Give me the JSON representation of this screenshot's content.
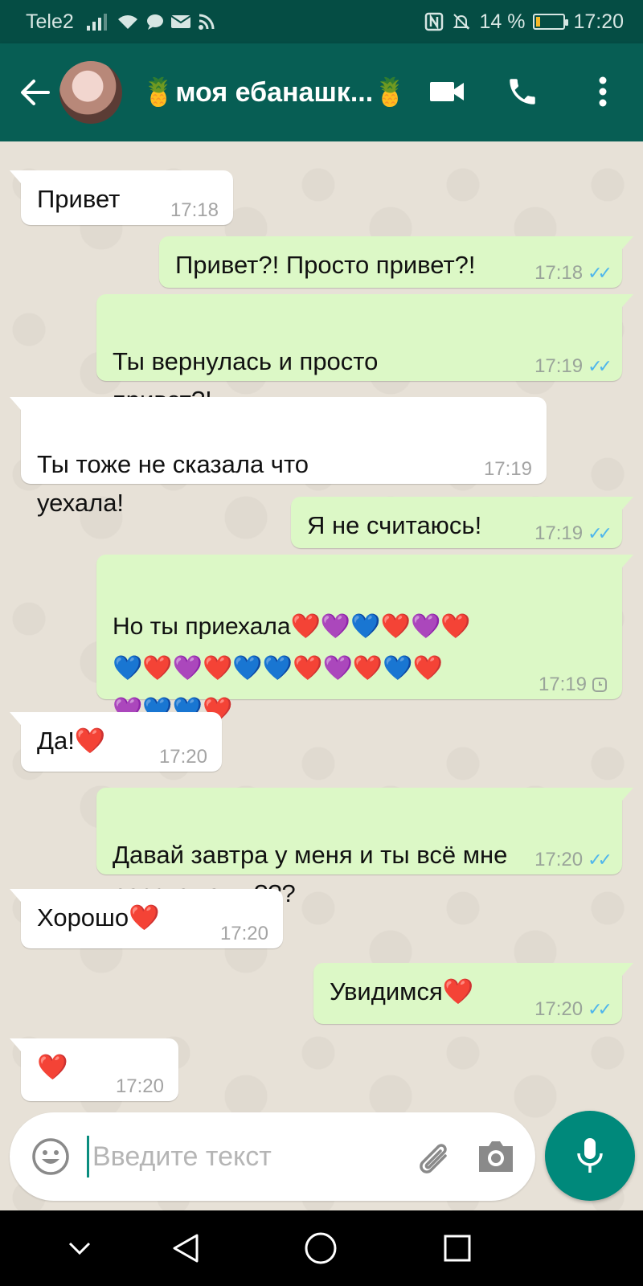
{
  "status_bar": {
    "carrier": "Tele2",
    "battery_percent": "14 %",
    "battery_level": 0.14,
    "time": "17:20"
  },
  "header": {
    "contact_name": "🍍моя ебанашк...🍍"
  },
  "messages": [
    {
      "dir": "in",
      "text": "Привет",
      "time": "17:18"
    },
    {
      "dir": "out",
      "text": "Привет?! Просто привет?!",
      "time": "17:18",
      "status": "read"
    },
    {
      "dir": "out",
      "text": "Ты вернулась и просто\nпривет?!",
      "time": "17:19",
      "status": "read"
    },
    {
      "dir": "in",
      "text": "Ты тоже не сказала что\nуехала!",
      "time": "17:19"
    },
    {
      "dir": "out",
      "text": "Я не считаюсь!",
      "time": "17:19",
      "status": "read"
    },
    {
      "dir": "out",
      "text": "Но ты приехала❤️💜💙❤️💜❤️\n💙❤️💜❤️💙💙❤️💜❤️💙❤️\n💜💙💙❤️",
      "time": "17:19",
      "status": "pending"
    },
    {
      "dir": "in",
      "text": "Да!❤️",
      "time": "17:20"
    },
    {
      "dir": "out",
      "text": "Давай завтра у меня и ты всё мне\nрасскажешь???",
      "time": "17:20",
      "status": "read"
    },
    {
      "dir": "in",
      "text": "Хорошо❤️",
      "time": "17:20"
    },
    {
      "dir": "out",
      "text": "Увидимся❤️",
      "time": "17:20",
      "status": "read"
    },
    {
      "dir": "in",
      "text": "❤️",
      "time": "17:20"
    }
  ],
  "composer": {
    "placeholder": "Введите текст"
  },
  "icons": {
    "back": "arrow-left-icon",
    "video": "video-camera-icon",
    "call": "phone-icon",
    "menu": "more-vertical-icon",
    "emoji": "smiley-icon",
    "attach": "paperclip-icon",
    "camera": "camera-icon",
    "mic": "microphone-icon"
  },
  "colors": {
    "header": "#075e54",
    "status_bar": "#054d44",
    "outgoing_bubble": "#dcf8c6",
    "incoming_bubble": "#ffffff",
    "read_ticks": "#4fb6ec",
    "mic_button": "#00897b"
  }
}
